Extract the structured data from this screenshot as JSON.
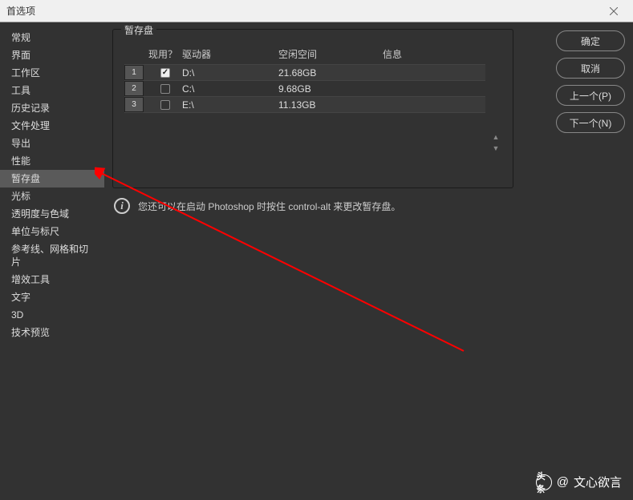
{
  "titlebar": {
    "title": "首选项"
  },
  "sidebar": {
    "items": [
      {
        "label": "常规"
      },
      {
        "label": "界面"
      },
      {
        "label": "工作区"
      },
      {
        "label": "工具"
      },
      {
        "label": "历史记录"
      },
      {
        "label": "文件处理"
      },
      {
        "label": "导出"
      },
      {
        "label": "性能"
      },
      {
        "label": "暂存盘",
        "selected": true
      },
      {
        "label": "光标"
      },
      {
        "label": "透明度与色域"
      },
      {
        "label": "单位与标尺"
      },
      {
        "label": "参考线、网格和切片"
      },
      {
        "label": "增效工具"
      },
      {
        "label": "文字"
      },
      {
        "label": "3D"
      },
      {
        "label": "技术预览"
      }
    ]
  },
  "panel": {
    "title": "暂存盘",
    "headers": {
      "active": "现用？",
      "drive": "驱动器",
      "free": "空闲空间",
      "info": "信息"
    },
    "rows": [
      {
        "idx": "1",
        "checked": true,
        "drive": "D:\\",
        "free": "21.68GB"
      },
      {
        "idx": "2",
        "checked": false,
        "drive": "C:\\",
        "free": "9.68GB"
      },
      {
        "idx": "3",
        "checked": false,
        "drive": "E:\\",
        "free": "11.13GB"
      }
    ],
    "hint": "您还可以在启动 Photoshop 时按住 control-alt 来更改暂存盘。"
  },
  "buttons": {
    "ok": "确定",
    "cancel": "取消",
    "prev": "上一个(P)",
    "next": "下一个(N)"
  },
  "watermark": {
    "logo": "头条",
    "at": "@",
    "name": "文心欲言"
  }
}
